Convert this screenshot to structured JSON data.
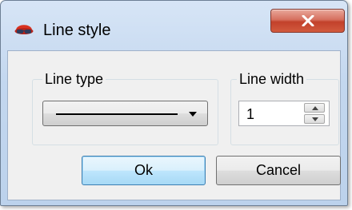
{
  "window": {
    "title": "Line style",
    "close_icon": "close-x-icon",
    "app_icon": "hat-icon"
  },
  "line_type": {
    "legend": "Line type",
    "selected_icon": "solid-line"
  },
  "line_width": {
    "legend": "Line width",
    "value": "1"
  },
  "buttons": {
    "ok_label": "Ok",
    "cancel_label": "Cancel"
  },
  "colors": {
    "close_button": "#c2412b",
    "default_button_border": "#3c7fb1"
  }
}
